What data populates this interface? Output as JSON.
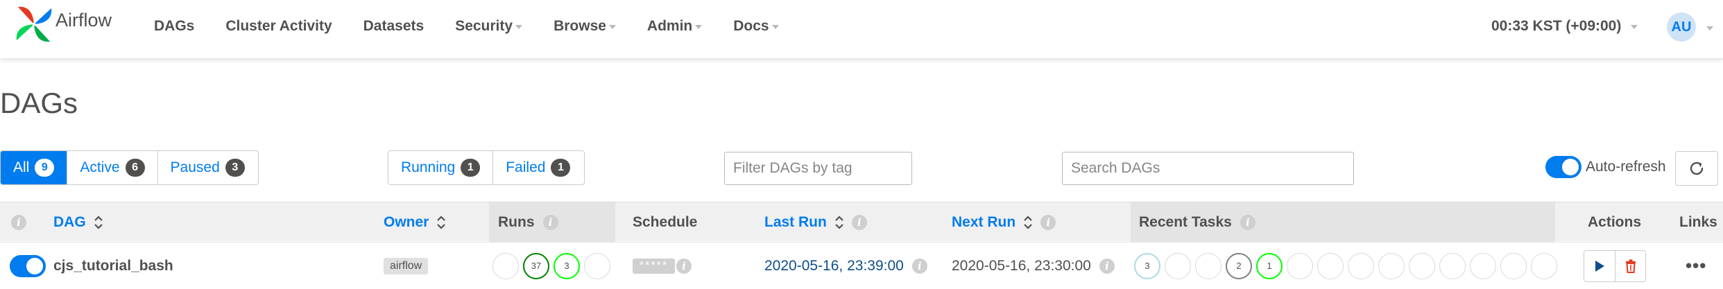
{
  "app": {
    "brand_name": "Airflow",
    "brand_colors": [
      "#017cee",
      "#00ad46",
      "#e43921",
      "#04d659"
    ]
  },
  "nav": {
    "items": [
      {
        "label": "DAGs",
        "has_dropdown": false
      },
      {
        "label": "Cluster Activity",
        "has_dropdown": false
      },
      {
        "label": "Datasets",
        "has_dropdown": false
      },
      {
        "label": "Security",
        "has_dropdown": true
      },
      {
        "label": "Browse",
        "has_dropdown": true
      },
      {
        "label": "Admin",
        "has_dropdown": true
      },
      {
        "label": "Docs",
        "has_dropdown": true
      }
    ],
    "time": "00:33 KST (+09:00)",
    "user_initials": "AU"
  },
  "page": {
    "title": "DAGs"
  },
  "filters": {
    "status_tabs": [
      {
        "label": "All",
        "count": "9",
        "active": true
      },
      {
        "label": "Active",
        "count": "6",
        "active": false
      },
      {
        "label": "Paused",
        "count": "3",
        "active": false
      }
    ],
    "run_tabs": [
      {
        "label": "Running",
        "count": "1"
      },
      {
        "label": "Failed",
        "count": "1"
      }
    ],
    "tag_filter_placeholder": "Filter DAGs by tag",
    "search_placeholder": "Search DAGs",
    "auto_refresh_label": "Auto-refresh",
    "auto_refresh_on": true
  },
  "table": {
    "columns": {
      "dag": "DAG",
      "owner": "Owner",
      "runs": "Runs",
      "schedule": "Schedule",
      "last_run": "Last Run",
      "next_run": "Next Run",
      "recent_tasks": "Recent Tasks",
      "actions": "Actions",
      "links": "Links"
    },
    "rows": [
      {
        "dag_id": "cjs_tutorial_bash",
        "paused": false,
        "owner": "airflow",
        "runs": [
          "",
          "37",
          "3",
          ""
        ],
        "schedule": "*****",
        "last_run": "2020-05-16, 23:39:00",
        "next_run": "2020-05-16, 23:30:00",
        "recent_tasks": [
          "3",
          "",
          "",
          "2",
          "1",
          "",
          "",
          "",
          "",
          "",
          "",
          "",
          "",
          ""
        ],
        "links_icon": "ellipsis-icon"
      }
    ]
  },
  "colors": {
    "accent": "#017cee",
    "success": "#008000",
    "running": "#00ff00",
    "queued": "#808080",
    "scheduled": "#add8e6",
    "delete": "#e43921"
  }
}
